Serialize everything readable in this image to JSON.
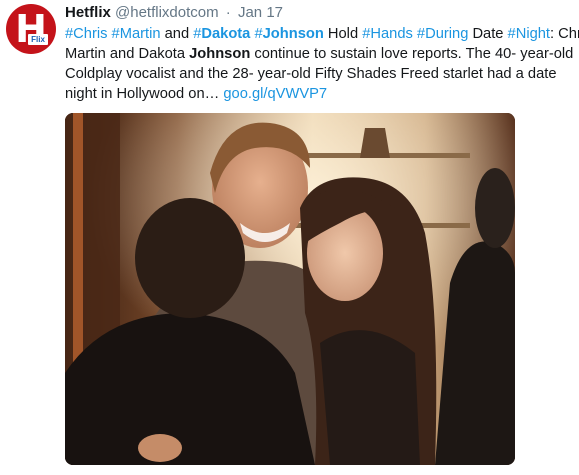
{
  "tweet": {
    "author_name": "Hetflix",
    "author_handle": "@hetflixdotcom",
    "separator": "·",
    "date": "Jan 17",
    "avatar_letter": "H",
    "avatar_badge": "Flix",
    "lines": [
      [
        {
          "t": "#Chris",
          "k": "ht"
        },
        {
          "t": " ",
          "k": "txt"
        },
        {
          "t": "#Martin",
          "k": "ht"
        },
        {
          "t": " and ",
          "k": "txt"
        },
        {
          "t": "#",
          "k": "ht"
        },
        {
          "t": "Dakota",
          "k": "htb"
        },
        {
          "t": " ",
          "k": "txt"
        },
        {
          "t": "#",
          "k": "ht"
        },
        {
          "t": "Johnson",
          "k": "htb"
        },
        {
          "t": " Hold ",
          "k": "txt"
        },
        {
          "t": "#Hands",
          "k": "ht"
        },
        {
          "t": " ",
          "k": "txt"
        },
        {
          "t": "#During",
          "k": "ht"
        },
        {
          "t": " Date ",
          "k": "txt"
        },
        {
          "t": "#Night",
          "k": "ht"
        },
        {
          "t": ": Chris",
          "k": "txt"
        }
      ],
      [
        {
          "t": "Martin and Dakota ",
          "k": "txt"
        },
        {
          "t": "Johnson",
          "k": "bold"
        },
        {
          "t": " continue to sustain love reports. The 40- year-old",
          "k": "txt"
        }
      ],
      [
        {
          "t": "Coldplay vocalist and the 28- year-old Fifty Shades Freed starlet had a date",
          "k": "txt"
        }
      ],
      [
        {
          "t": "night in Hollywood on… ",
          "k": "txt"
        },
        {
          "t": "goo.gl/qVWVP7",
          "k": "link"
        }
      ]
    ]
  },
  "colors": {
    "link": "#1b95e0",
    "avatar_bg": "#c4131a",
    "muted": "#657786"
  }
}
